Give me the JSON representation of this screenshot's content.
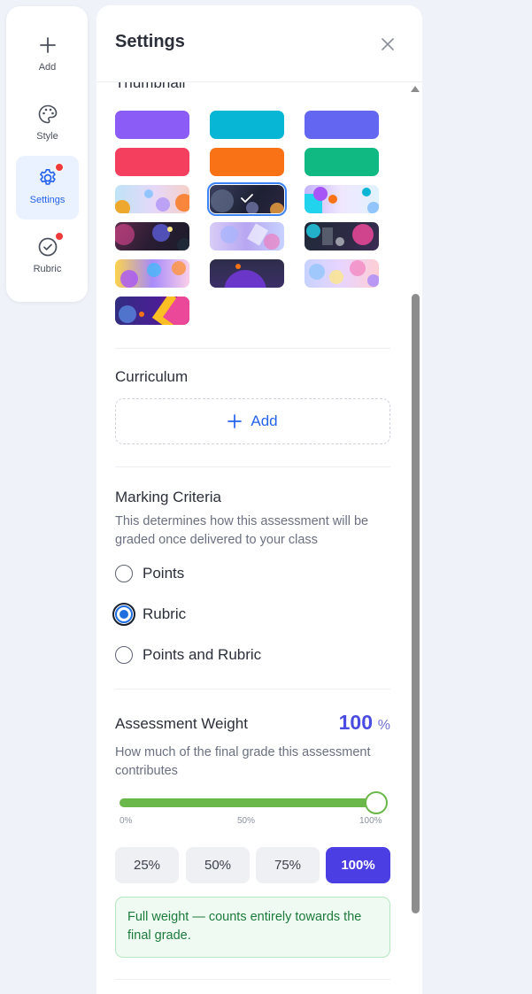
{
  "rail": {
    "items": [
      {
        "label": "Add",
        "icon": "plus-icon",
        "active": false
      },
      {
        "label": "Style",
        "icon": "palette-icon",
        "active": false
      },
      {
        "label": "Settings",
        "icon": "gear-icon",
        "active": true,
        "badge": true
      },
      {
        "label": "Rubric",
        "icon": "check-circle-icon",
        "active": false,
        "badge": true
      }
    ]
  },
  "panel": {
    "title": "Settings"
  },
  "thumbnail": {
    "title": "Thumbnail",
    "swatches": [
      {
        "kind": "solid",
        "color": "#8b5cf6"
      },
      {
        "kind": "solid",
        "color": "#06b6d4"
      },
      {
        "kind": "solid",
        "color": "#6366f1"
      },
      {
        "kind": "solid",
        "color": "#f43f5e"
      },
      {
        "kind": "solid",
        "color": "#f97316"
      },
      {
        "kind": "solid",
        "color": "#10b981"
      },
      {
        "kind": "image",
        "name": "abstract-light-1"
      },
      {
        "kind": "image",
        "name": "abstract-dark-1",
        "selected": true
      },
      {
        "kind": "image",
        "name": "abstract-light-2"
      },
      {
        "kind": "image",
        "name": "abstract-dark-2"
      },
      {
        "kind": "image",
        "name": "abstract-lilac"
      },
      {
        "kind": "image",
        "name": "abstract-dark-3"
      },
      {
        "kind": "image",
        "name": "abstract-warm"
      },
      {
        "kind": "image",
        "name": "abstract-dark-4"
      },
      {
        "kind": "image",
        "name": "abstract-pastel"
      },
      {
        "kind": "image",
        "name": "abstract-dark-5"
      }
    ]
  },
  "curriculum": {
    "title": "Curriculum",
    "add_label": "Add"
  },
  "marking": {
    "title": "Marking Criteria",
    "description": "This determines how this assessment will be graded once delivered to your class",
    "options": [
      {
        "label": "Points",
        "checked": false
      },
      {
        "label": "Rubric",
        "checked": true
      },
      {
        "label": "Points and Rubric",
        "checked": false
      }
    ]
  },
  "weight": {
    "title": "Assessment Weight",
    "value": "100",
    "unit": "%",
    "description": "How much of the final grade this assessment contributes",
    "percent": 100,
    "ticks": [
      "0%",
      "50%",
      "100%"
    ],
    "presets": [
      {
        "label": "25%",
        "active": false
      },
      {
        "label": "50%",
        "active": false
      },
      {
        "label": "75%",
        "active": false
      },
      {
        "label": "100%",
        "active": true
      }
    ],
    "note": "Full weight — counts entirely towards the final grade."
  },
  "colors": {
    "accent": "#2563eb",
    "primary_button": "#4b3ee2",
    "slider": "#6bb84a",
    "badge": "#ef3a3a"
  }
}
